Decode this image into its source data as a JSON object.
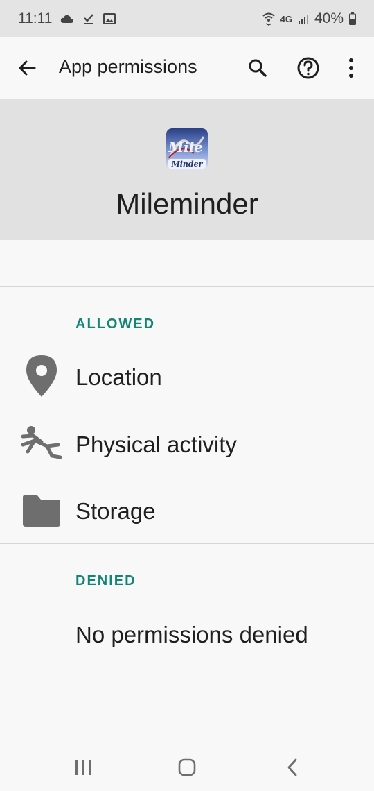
{
  "status_bar": {
    "time": "11:11",
    "left_icons": [
      "cloud-icon",
      "download-done-icon",
      "image-icon"
    ],
    "network": "4G",
    "battery": "40%"
  },
  "app_bar": {
    "title": "App permissions",
    "back_icon": "arrow-back-icon",
    "search_icon": "search-icon",
    "help_icon": "help-circle-icon",
    "more_icon": "more-vert-icon"
  },
  "app_header": {
    "app_name": "Mileminder",
    "logo_text": "Mile Minder"
  },
  "sections": {
    "allowed_title": "ALLOWED",
    "allowed": [
      {
        "label": "Location",
        "icon": "location-pin-icon"
      },
      {
        "label": "Physical activity",
        "icon": "physical-activity-icon"
      },
      {
        "label": "Storage",
        "icon": "folder-icon"
      }
    ],
    "denied_title": "DENIED",
    "denied_empty": "No permissions denied"
  },
  "nav_bar": {
    "recents_icon": "recents-icon",
    "home_icon": "home-icon",
    "back_icon": "nav-back-icon"
  },
  "colors": {
    "accent": "#138575",
    "header_bg": "#e1e1e1",
    "icon_gray": "#6e6e6e"
  }
}
